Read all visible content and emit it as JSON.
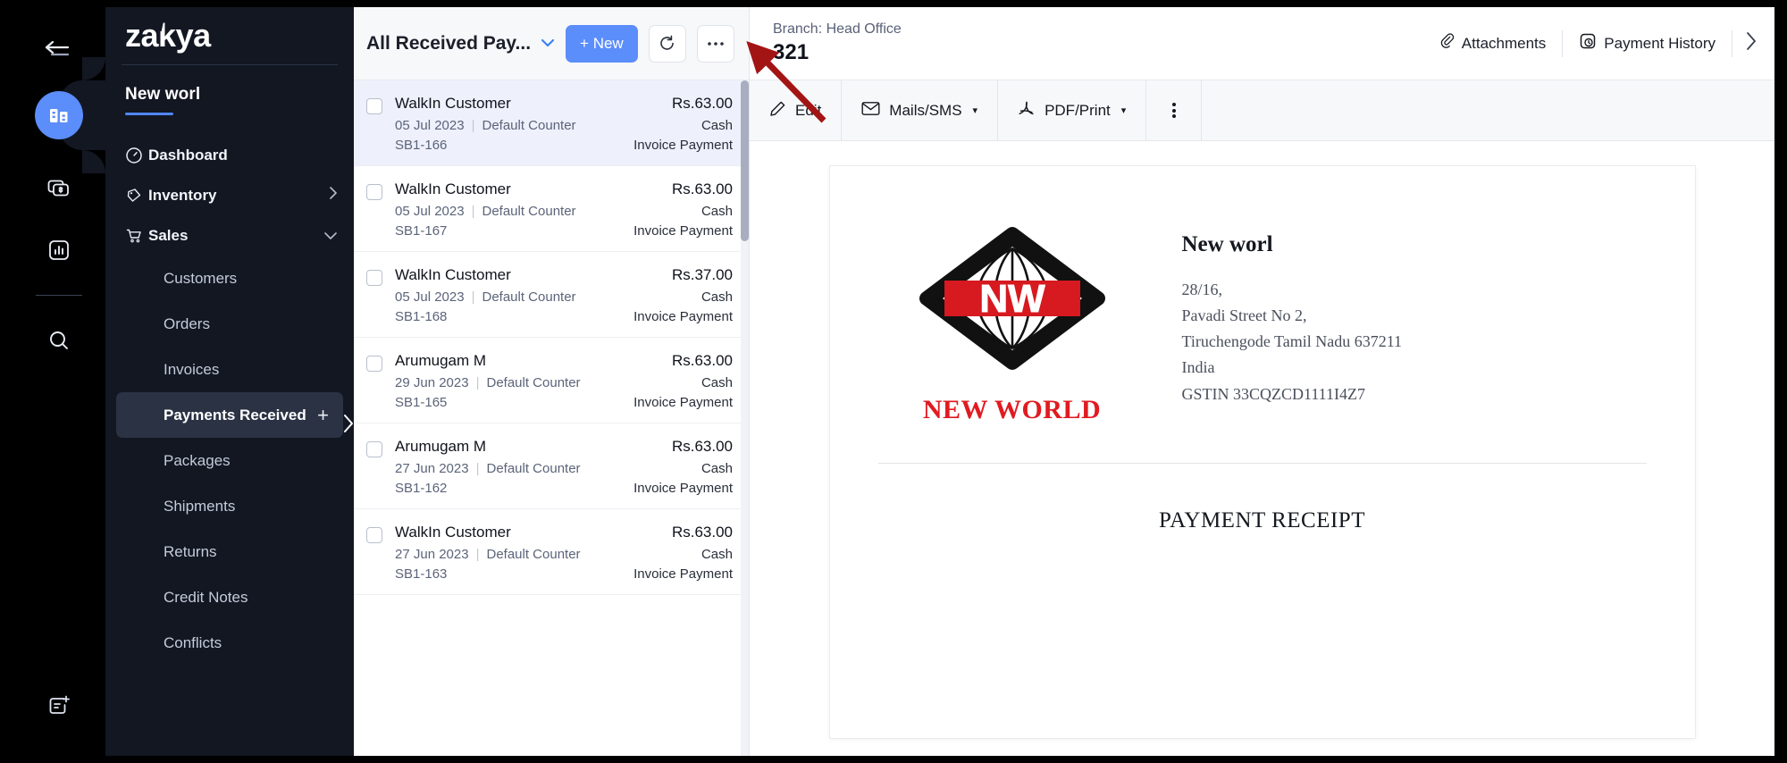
{
  "rail": {
    "collapse_icon": "collapse-left-icon",
    "items": [
      {
        "name": "org-building-icon",
        "active": true
      },
      {
        "name": "money-bills-icon",
        "active": false
      },
      {
        "name": "reports-bar-chart-icon",
        "active": false
      },
      {
        "name": "search-icon",
        "active": false
      }
    ],
    "bottom_item": {
      "name": "new-entry-icon"
    }
  },
  "sidebar": {
    "brand": "zakya",
    "workspace": "New worl",
    "nav": [
      {
        "label": "Dashboard",
        "icon": "speedometer-icon",
        "chevron": ""
      },
      {
        "label": "Inventory",
        "icon": "inventory-tag-icon",
        "chevron": "›"
      },
      {
        "label": "Sales",
        "icon": "shopping-cart-icon",
        "chevron": "⌄"
      }
    ],
    "sub_items": [
      {
        "label": "Customers",
        "active": false
      },
      {
        "label": "Orders",
        "active": false
      },
      {
        "label": "Invoices",
        "active": false
      },
      {
        "label": "Payments Received",
        "active": true,
        "plus": "+"
      },
      {
        "label": "Packages",
        "active": false
      },
      {
        "label": "Shipments",
        "active": false
      },
      {
        "label": "Returns",
        "active": false
      },
      {
        "label": "Credit Notes",
        "active": false
      },
      {
        "label": "Conflicts",
        "active": false
      }
    ]
  },
  "list_panel": {
    "title": "All Received Pay...",
    "caret": "⌄",
    "new_button": "+ New",
    "refresh_icon": "refresh-icon",
    "more_icon": "more-horizontal-icon",
    "rows": [
      {
        "name": "WalkIn Customer",
        "date": "05 Jul 2023",
        "counter": "Default Counter",
        "ref": "SB1-166",
        "amount": "Rs.63.00",
        "mode": "Cash",
        "type": "Invoice Payment",
        "selected": true
      },
      {
        "name": "WalkIn Customer",
        "date": "05 Jul 2023",
        "counter": "Default Counter",
        "ref": "SB1-167",
        "amount": "Rs.63.00",
        "mode": "Cash",
        "type": "Invoice Payment",
        "selected": false
      },
      {
        "name": "WalkIn Customer",
        "date": "05 Jul 2023",
        "counter": "Default Counter",
        "ref": "SB1-168",
        "amount": "Rs.37.00",
        "mode": "Cash",
        "type": "Invoice Payment",
        "selected": false
      },
      {
        "name": "Arumugam M",
        "date": "29 Jun 2023",
        "counter": "Default Counter",
        "ref": "SB1-165",
        "amount": "Rs.63.00",
        "mode": "Cash",
        "type": "Invoice Payment",
        "selected": false
      },
      {
        "name": "Arumugam M",
        "date": "27 Jun 2023",
        "counter": "Default Counter",
        "ref": "SB1-162",
        "amount": "Rs.63.00",
        "mode": "Cash",
        "type": "Invoice Payment",
        "selected": false
      },
      {
        "name": "WalkIn Customer",
        "date": "27 Jun 2023",
        "counter": "Default Counter",
        "ref": "SB1-163",
        "amount": "Rs.63.00",
        "mode": "Cash",
        "type": "Invoice Payment",
        "selected": false
      }
    ]
  },
  "detail": {
    "branch_label": "Branch: Head Office",
    "record_number": "321",
    "header_actions": [
      {
        "label": "Attachments",
        "icon": "paperclip-icon"
      },
      {
        "label": "Payment History",
        "icon": "history-clock-icon"
      }
    ],
    "header_chevron": "›",
    "action_bar": {
      "edit": "Edit",
      "mails_sms": "Mails/SMS",
      "pdf_print": "PDF/Print",
      "dropdown_caret": "▾",
      "more_icon": "more-vertical-icon"
    },
    "document": {
      "logo_brand": "NW",
      "logo_text": "NEW WORLD",
      "company": "New worl",
      "address_lines": [
        "28/16,",
        "Pavadi Street No 2,",
        "Tiruchengode Tamil Nadu 637211",
        "India",
        "GSTIN 33CQZCD1111I4Z7"
      ],
      "receipt_title": "PAYMENT RECEIPT"
    }
  },
  "colors": {
    "accent_blue": "#5b8dfb",
    "sidebar_dark": "#121722",
    "rail_black": "#000000",
    "logo_red": "#e01b21",
    "annotation_red": "#a31515"
  }
}
